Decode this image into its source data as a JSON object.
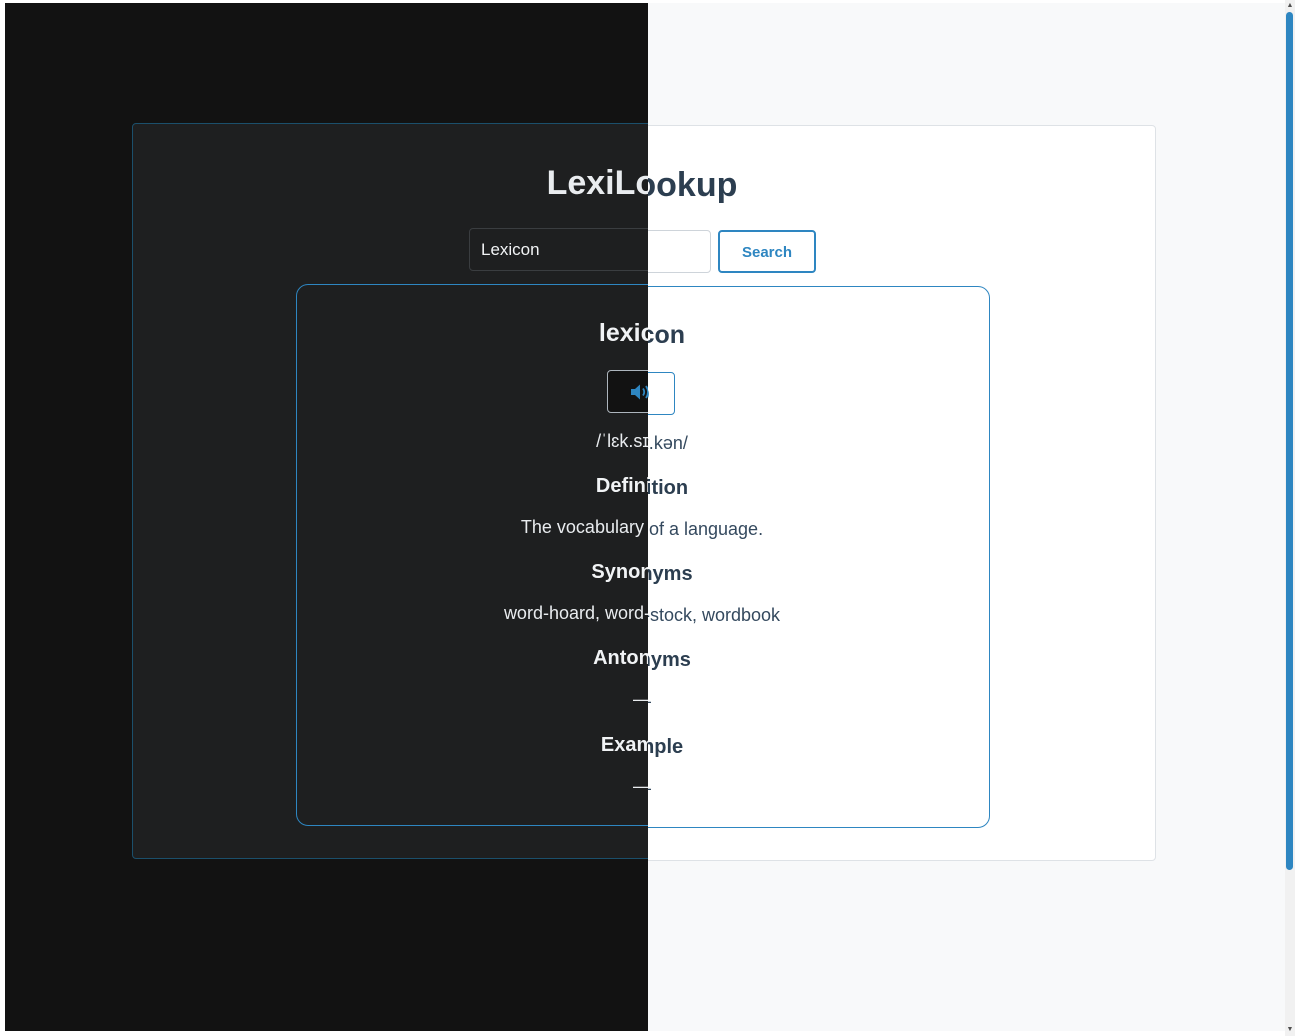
{
  "app": {
    "title": "LexiLookup"
  },
  "search": {
    "value": "Lexicon",
    "button_label": "Search"
  },
  "result": {
    "word": "lexicon",
    "audio_icon": "speaker-volume-icon",
    "phonetic": "/ˈlɛk.sɪ.kən/",
    "definition_heading": "Definition",
    "definition": "The vocabulary of a language.",
    "synonyms_heading": "Synonyms",
    "synonyms": "word-hoard, word-stock, wordbook",
    "antonyms_heading": "Antonyms",
    "antonyms": "—",
    "example_heading": "Example",
    "example": "—"
  },
  "colors": {
    "accent": "#2e86c1",
    "dark_background": "#121212",
    "dark_card": "#1e1f20",
    "light_background": "#f8f9fa",
    "light_card": "#ffffff",
    "light_text": "#2c3e50"
  }
}
